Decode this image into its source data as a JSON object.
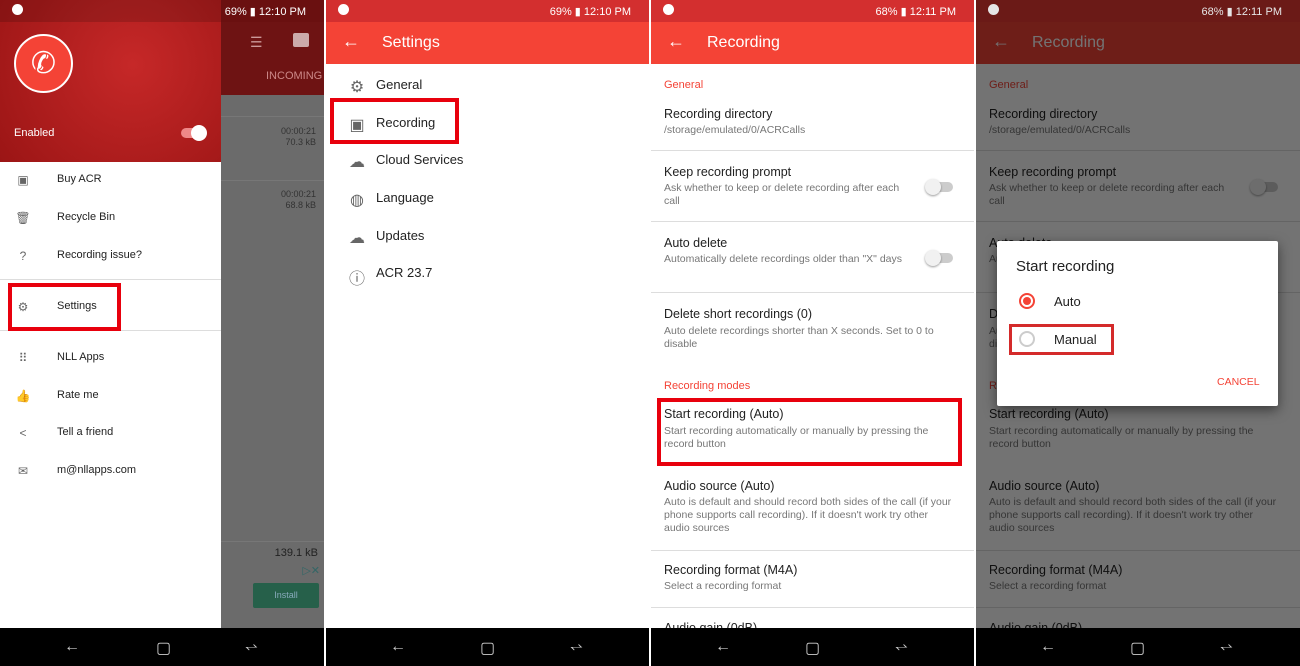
{
  "colors": {
    "accent": "#f44336",
    "highlight": "#e8000d",
    "drawer_header": "#b71c1c"
  },
  "panel1": {
    "status": {
      "battery": "69%",
      "time": "12:10 PM"
    },
    "drawer": {
      "enabled_label": "Enabled",
      "enabled": true,
      "items": [
        {
          "label": "Buy ACR",
          "icon": "shop-icon"
        },
        {
          "label": "Recycle Bin",
          "icon": "trash-icon"
        },
        {
          "label": "Recording issue?",
          "icon": "help-icon"
        },
        {
          "label": "Settings",
          "icon": "gear-icon"
        },
        {
          "label": "NLL Apps",
          "icon": "apps-icon"
        },
        {
          "label": "Rate me",
          "icon": "thumbs-up-icon"
        },
        {
          "label": "Tell a friend",
          "icon": "share-icon"
        },
        {
          "label": "m@nllapps.com",
          "icon": "mail-icon"
        }
      ]
    },
    "background": {
      "tab": "INCOMING",
      "records": [
        {
          "duration": "00:00:21",
          "size": "70.3 kB"
        },
        {
          "duration": "00:00:21",
          "size": "68.8 kB"
        }
      ],
      "total": "139.1 kB",
      "install": "Install"
    }
  },
  "panel2": {
    "status": {
      "battery": "69%",
      "time": "12:10 PM"
    },
    "title": "Settings",
    "items": [
      {
        "label": "General",
        "icon": "gear-icon"
      },
      {
        "label": "Recording",
        "icon": "save-icon"
      },
      {
        "label": "Cloud Services",
        "icon": "cloud-upload-icon"
      },
      {
        "label": "Language",
        "icon": "globe-icon"
      },
      {
        "label": "Updates",
        "icon": "check-cloud-icon"
      },
      {
        "label": "ACR 23.7",
        "icon": "info-icon"
      }
    ]
  },
  "panel3": {
    "status": {
      "battery": "68%",
      "time": "12:11 PM"
    },
    "title": "Recording",
    "general_header": "General",
    "modes_header": "Recording modes",
    "rows": [
      {
        "title": "Recording directory",
        "desc": "/storage/emulated/0/ACRCalls"
      },
      {
        "title": "Keep recording prompt",
        "desc": "Ask whether to keep or delete recording after each call",
        "toggle": false
      },
      {
        "title": "Auto delete",
        "desc": "Automatically delete recordings older than \"X\" days",
        "toggle": false
      },
      {
        "title": "Delete short recordings (0)",
        "desc": "Auto delete recordings shorter than X seconds. Set to 0 to disable"
      },
      {
        "title": "Start recording (Auto)",
        "desc": "Start recording automatically or manually by pressing the record button"
      },
      {
        "title": "Audio source (Auto)",
        "desc": "Auto is default and should record both sides of the call (if your phone supports call recording). If it doesn't work try other audio sources"
      },
      {
        "title": "Recording format (M4A)",
        "desc": "Select a recording format"
      },
      {
        "title": "Audio gain (0dB)",
        "desc": ""
      }
    ]
  },
  "panel4": {
    "status": {
      "battery": "68%",
      "time": "12:11 PM"
    },
    "dialog": {
      "title": "Start recording",
      "options": [
        {
          "label": "Auto",
          "selected": true
        },
        {
          "label": "Manual",
          "selected": false
        }
      ],
      "cancel": "CANCEL"
    }
  }
}
